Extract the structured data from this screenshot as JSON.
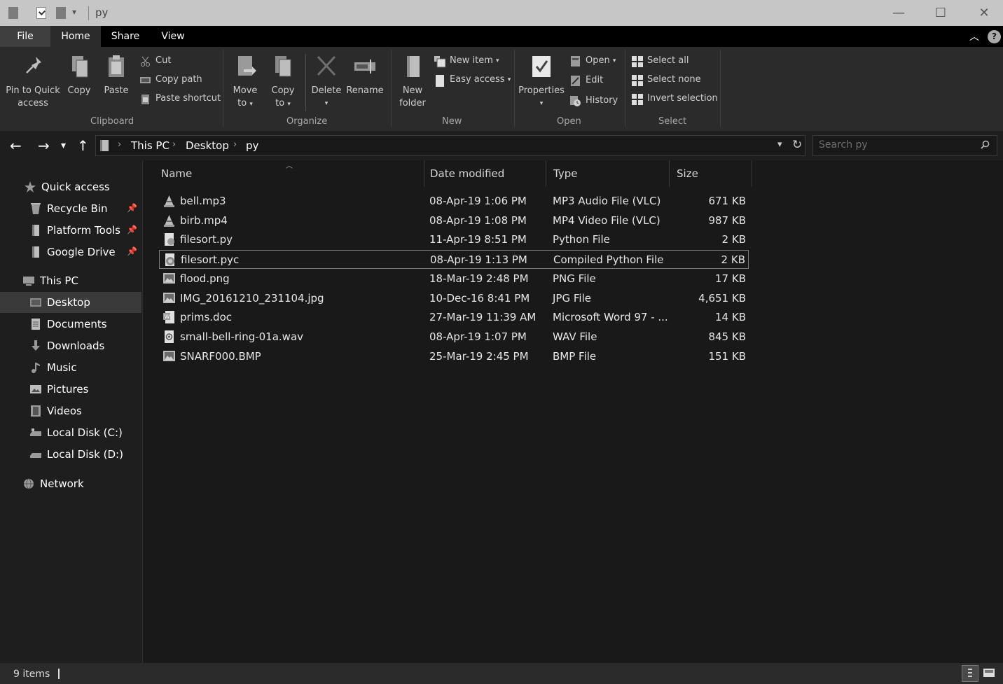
{
  "window": {
    "title": "py",
    "minimize_glyph": "—",
    "maximize_glyph": "☐",
    "close_glyph": "✕"
  },
  "ribbon_tabs": [
    {
      "label": "File"
    },
    {
      "label": "Home"
    },
    {
      "label": "Share"
    },
    {
      "label": "View"
    }
  ],
  "ribbon": {
    "clipboard": {
      "pin_label_1": "Pin to Quick",
      "pin_label_2": "access",
      "copy": "Copy",
      "paste": "Paste",
      "cut": "Cut",
      "copy_path": "Copy path",
      "paste_shortcut": "Paste shortcut",
      "group": "Clipboard"
    },
    "organize": {
      "move_to_1": "Move",
      "move_to_2": "to",
      "copy_to_1": "Copy",
      "copy_to_2": "to",
      "delete": "Delete",
      "rename": "Rename",
      "group": "Organize"
    },
    "new": {
      "new_folder_1": "New",
      "new_folder_2": "folder",
      "new_item": "New item",
      "easy_access": "Easy access",
      "group": "New"
    },
    "open": {
      "properties": "Properties",
      "open": "Open",
      "edit": "Edit",
      "history": "History",
      "group": "Open"
    },
    "select": {
      "select_all": "Select all",
      "select_none": "Select none",
      "invert_selection": "Invert selection",
      "group": "Select"
    }
  },
  "address": {
    "crumbs": [
      "This PC",
      "Desktop",
      "py"
    ],
    "refresh_glyph": "↻"
  },
  "search": {
    "placeholder": "Search py"
  },
  "nav": {
    "quick_access": "Quick access",
    "pinned": [
      "Recycle Bin",
      "Platform Tools",
      "Google Drive"
    ],
    "this_pc": "This PC",
    "this_pc_items": [
      "Desktop",
      "Documents",
      "Downloads",
      "Music",
      "Pictures",
      "Videos",
      "Local Disk (C:)",
      "Local Disk (D:)"
    ],
    "network": "Network",
    "selected": "Desktop"
  },
  "columns": {
    "name": "Name",
    "date": "Date modified",
    "type": "Type",
    "size": "Size"
  },
  "files": [
    {
      "name": "bell.mp3",
      "date": "08-Apr-19 1:06 PM",
      "type": "MP3 Audio File (VLC)",
      "size": "671 KB",
      "icon": "vlc-icon"
    },
    {
      "name": "birb.mp4",
      "date": "08-Apr-19 1:08 PM",
      "type": "MP4 Video File (VLC)",
      "size": "987 KB",
      "icon": "vlc-icon"
    },
    {
      "name": "filesort.py",
      "date": "11-Apr-19 8:51 PM",
      "type": "Python File",
      "size": "2 KB",
      "icon": "python-file-icon"
    },
    {
      "name": "filesort.pyc",
      "date": "08-Apr-19 1:13 PM",
      "type": "Compiled Python File",
      "size": "2 KB",
      "icon": "compiled-python-icon"
    },
    {
      "name": "flood.png",
      "date": "18-Mar-19 2:48 PM",
      "type": "PNG File",
      "size": "17 KB",
      "icon": "image-file-icon"
    },
    {
      "name": "IMG_20161210_231104.jpg",
      "date": "10-Dec-16 8:41 PM",
      "type": "JPG File",
      "size": "4,651 KB",
      "icon": "image-file-icon"
    },
    {
      "name": "prims.doc",
      "date": "27-Mar-19 11:39 AM",
      "type": "Microsoft Word 97 - ...",
      "size": "14 KB",
      "icon": "word-doc-icon"
    },
    {
      "name": "small-bell-ring-01a.wav",
      "date": "08-Apr-19 1:07 PM",
      "type": "WAV File",
      "size": "845 KB",
      "icon": "audio-file-icon"
    },
    {
      "name": "SNARF000.BMP",
      "date": "25-Mar-19 2:45 PM",
      "type": "BMP File",
      "size": "151 KB",
      "icon": "image-file-icon"
    }
  ],
  "focused_file": "filesort.pyc",
  "status": {
    "item_count": "9 items"
  }
}
